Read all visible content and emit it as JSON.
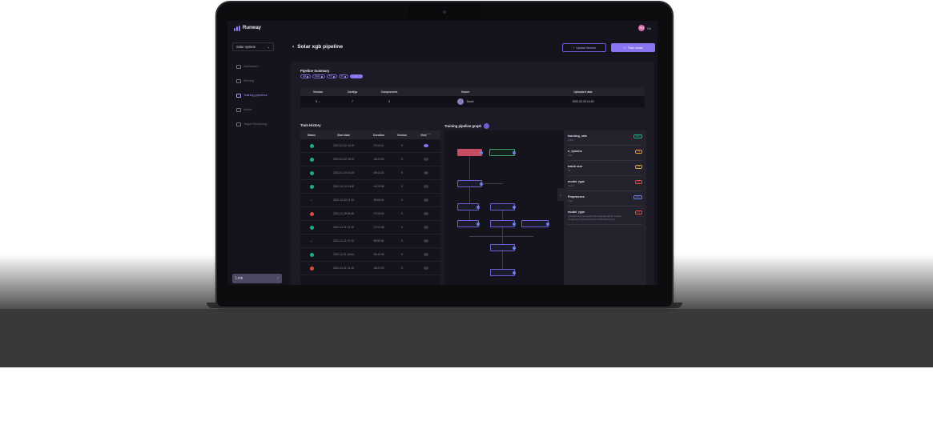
{
  "colors": {
    "accent": "#8b74f4",
    "success": "#19b089",
    "danger": "#e0493e",
    "background": "#15141c"
  },
  "app": {
    "logo": "Runway"
  },
  "user": {
    "initials": "SN",
    "name": "Kk"
  },
  "sidebar": {
    "project": "Solar system",
    "items": [
      {
        "label": "Dashboard",
        "icon": "dashboard-icon"
      },
      {
        "label": "Serving",
        "icon": "serving-icon"
      },
      {
        "label": "Training pipelines",
        "icon": "pipeline-icon"
      },
      {
        "label": "Model",
        "icon": "model-icon"
      },
      {
        "label": "Target Monitoring",
        "icon": "monitor-icon"
      }
    ],
    "link_button": "Link"
  },
  "header": {
    "title": "Solar xgb pipeline",
    "upload_label": "Upload Version",
    "train_label": "Train model"
  },
  "summary": {
    "title": "Pipeline Summary",
    "chips": [
      "xgb",
      "beam",
      "ITY",
      "12",
      "+"
    ],
    "columns": [
      "Version",
      "Configs",
      "Components",
      "Owner",
      "Uploaded date"
    ],
    "row": {
      "version": "5",
      "configs": "7",
      "components": "3",
      "owner": "David",
      "uploaded": "2022-02-03 14:15"
    }
  },
  "history": {
    "title": "Train History",
    "columns": [
      "Status",
      "Start date",
      "Duration",
      "Version",
      "View"
    ],
    "view_sub": "result",
    "rows": [
      {
        "status": "success",
        "start": "2022-02-02 14:15",
        "duration": "07:04:21",
        "version": "5",
        "view": true
      },
      {
        "status": "success",
        "start": "2022-01-22 15:23",
        "duration": "05:21:00",
        "version": "5",
        "view": false
      },
      {
        "status": "success",
        "start": "2022-01-10 16:15",
        "duration": "08:43:24",
        "version": "5",
        "view": false
      },
      {
        "status": "success",
        "start": "2021-12-14 13:45",
        "duration": "04:23:08",
        "version": "5",
        "view": false
      },
      {
        "status": "running",
        "start": "2021-12-02 11:13",
        "duration": "05:52:24",
        "version": "5",
        "view": false
      },
      {
        "status": "fail",
        "start": "2021-11-28 05:45",
        "duration": "07:05:23",
        "version": "5",
        "view": false
      },
      {
        "status": "success",
        "start": "2021-11-21 14:15",
        "duration": "07:01:08",
        "version": "5",
        "view": false
      },
      {
        "status": "running",
        "start": "2021-11-21 07:12",
        "duration": "06:52:31",
        "version": "5",
        "view": false
      },
      {
        "status": "success",
        "start": "2021-11-01 18:54",
        "duration": "05:42:35",
        "version": "5",
        "view": false
      },
      {
        "status": "fail",
        "start": "2021-11-01 14:15",
        "duration": "05:21:23",
        "version": "5",
        "view": false
      }
    ]
  },
  "graph": {
    "title": "Training pipeline graph",
    "toggle": "›"
  },
  "params": [
    {
      "name": "learning_rate",
      "value": "0.001",
      "tag": "float",
      "tag_color": "#19b089"
    },
    {
      "name": "n_epochs",
      "value": "100",
      "tag": "int",
      "tag_color": "#e8973a"
    },
    {
      "name": "batch size",
      "value": "32",
      "tag": "int",
      "tag_color": "#e8973a"
    },
    {
      "name": "model_type",
      "value": "\"tests\"",
      "tag": "str",
      "tag_color": "#e0493e"
    },
    {
      "name": "Preprocess",
      "value": "True",
      "tag": "bool",
      "tag_color": "#6a7ee8"
    },
    {
      "name": "model_type",
      "value": "\"postgresql+psycopg2://devicekeeper@db.runway-postgresql.runway.cluster.local:5432/serving\"",
      "tag": "str",
      "tag_color": "#e0493e"
    }
  ]
}
